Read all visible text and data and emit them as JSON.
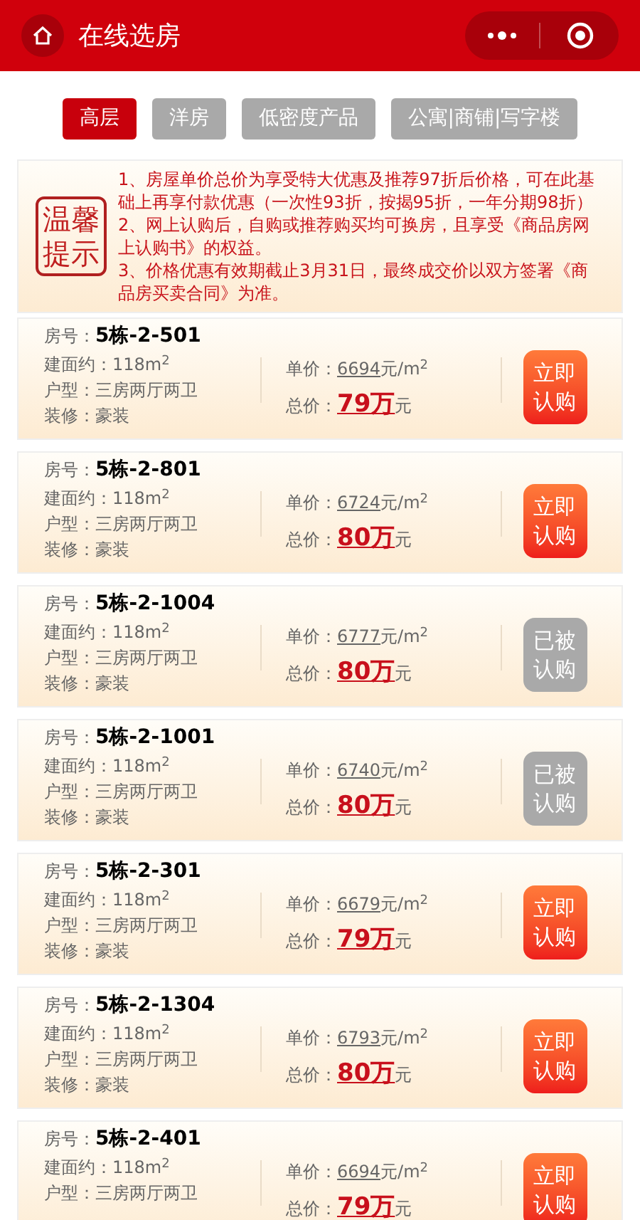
{
  "header": {
    "title": "在线选房"
  },
  "tabs": [
    {
      "label": "高层",
      "selected": true
    },
    {
      "label": "洋房",
      "selected": false
    },
    {
      "label": "低密度产品",
      "selected": false
    },
    {
      "label": "公寓|商铺|写字楼",
      "selected": false
    }
  ],
  "notice": {
    "badge": "温馨提示",
    "lines": [
      "1、房屋单价总价为享受特大优惠及推荐97折后价格，可在此基础上再享付款优惠（一次性93折，按揭95折，一年分期98折）",
      "2、网上认购后，自购或推荐购买均可换房，且享受《商品房网上认购书》的权益。",
      "3、价格优惠有效期截止3月31日，最终成交价以双方签署《商品房买卖合同》为准。"
    ]
  },
  "rooms": [
    {
      "room_label": "房号：",
      "room": "5栋-2-501",
      "area": "建面约：118m$^{2}$",
      "layout": "户型：三房两厅两卫",
      "decor": "装修：豪装",
      "unit_label": "单价：",
      "unit_price": "6694",
      "unit": "元/m$^{2}$",
      "total_label": "总价：",
      "total": "79万",
      "total_unit": "元",
      "sold": false,
      "button": "立即认购"
    },
    {
      "room_label": "房号：",
      "room": "5栋-2-801",
      "area": "建面约：118m$^{2}$",
      "layout": "户型：三房两厅两卫",
      "decor": "装修：豪装",
      "unit_label": "单价：",
      "unit_price": "6724",
      "unit": "元/m$^{2}$",
      "total_label": "总价：",
      "total": "80万",
      "total_unit": "元",
      "sold": false,
      "button": "立即认购"
    },
    {
      "room_label": "房号：",
      "room": "5栋-2-1004",
      "area": "建面约：118m$^{2}$",
      "layout": "户型：三房两厅两卫",
      "decor": "装修：豪装",
      "unit_label": "单价：",
      "unit_price": "6777",
      "unit": "元/m$^{2}$",
      "total_label": "总价：",
      "total": "80万",
      "total_unit": "元",
      "sold": true,
      "button": "已被认购"
    },
    {
      "room_label": "房号：",
      "room": "5栋-2-1001",
      "area": "建面约：118m$^{2}$",
      "layout": "户型：三房两厅两卫",
      "decor": "装修：豪装",
      "unit_label": "单价：",
      "unit_price": "6740",
      "unit": "元/m$^{2}$",
      "total_label": "总价：",
      "total": "80万",
      "total_unit": "元",
      "sold": true,
      "button": "已被认购"
    },
    {
      "room_label": "房号：",
      "room": "5栋-2-301",
      "area": "建面约：118m$^{2}$",
      "layout": "户型：三房两厅两卫",
      "decor": "装修：豪装",
      "unit_label": "单价：",
      "unit_price": "6679",
      "unit": "元/m$^{2}$",
      "total_label": "总价：",
      "total": "79万",
      "total_unit": "元",
      "sold": false,
      "button": "立即认购"
    },
    {
      "room_label": "房号：",
      "room": "5栋-2-1304",
      "area": "建面约：118m$^{2}$",
      "layout": "户型：三房两厅两卫",
      "decor": "装修：豪装",
      "unit_label": "单价：",
      "unit_price": "6793",
      "unit": "元/m$^{2}$",
      "total_label": "总价：",
      "total": "80万",
      "total_unit": "元",
      "sold": false,
      "button": "立即认购"
    },
    {
      "room_label": "房号：",
      "room": "5栋-2-401",
      "area": "建面约：118m$^{2}$",
      "layout": "户型：三房两厅两卫",
      "unit_label": "单价：",
      "unit_price": "6694",
      "unit": "元/m$^{2}$",
      "total_label": "总价：",
      "total": "79万",
      "total_unit": "元",
      "sold": false,
      "button": "立即认购"
    }
  ]
}
